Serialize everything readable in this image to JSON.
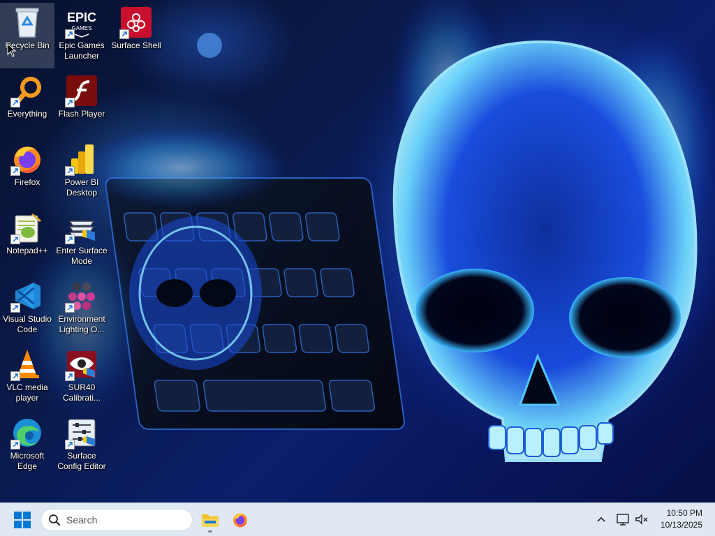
{
  "desktop": {
    "wallpaper": "blue-flame-skull-keyboard",
    "icons": [
      {
        "id": "recycle-bin",
        "label": "Recycle Bin",
        "icon": "recycle-bin-icon",
        "shortcut": false,
        "selected": true
      },
      {
        "id": "epic-games",
        "label": "Epic Games Launcher",
        "icon": "epic-games-icon",
        "shortcut": true
      },
      {
        "id": "surface-shell",
        "label": "Surface Shell",
        "icon": "surface-shell-icon",
        "shortcut": true
      },
      {
        "id": "everything",
        "label": "Everything",
        "icon": "magnifier-icon",
        "shortcut": true
      },
      {
        "id": "flash-player",
        "label": "Flash Player",
        "icon": "flash-icon",
        "shortcut": true
      },
      {
        "id": "firefox",
        "label": "Firefox",
        "icon": "firefox-icon",
        "shortcut": true
      },
      {
        "id": "power-bi",
        "label": "Power BI Desktop",
        "icon": "power-bi-icon",
        "shortcut": true
      },
      {
        "id": "notepadpp",
        "label": "Notepad++",
        "icon": "notepad-plus-plus-icon",
        "shortcut": true
      },
      {
        "id": "enter-surface-mode",
        "label": "Enter Surface Mode",
        "icon": "surface-mode-icon",
        "shortcut": true
      },
      {
        "id": "vscode",
        "label": "Visual Studio Code",
        "icon": "vscode-icon",
        "shortcut": true
      },
      {
        "id": "environment-lighting",
        "label": "Environment Lighting O...",
        "icon": "environment-lighting-icon",
        "shortcut": true
      },
      {
        "id": "vlc",
        "label": "VLC media player",
        "icon": "vlc-cone-icon",
        "shortcut": true
      },
      {
        "id": "sur40",
        "label": "SUR40 Calibrati...",
        "icon": "sur40-eye-icon",
        "shortcut": true
      },
      {
        "id": "edge",
        "label": "Microsoft Edge",
        "icon": "edge-icon",
        "shortcut": true
      },
      {
        "id": "surface-config",
        "label": "Surface Config Editor",
        "icon": "config-sliders-icon",
        "shortcut": true
      }
    ]
  },
  "taskbar": {
    "search_placeholder": "Search",
    "apps": [
      {
        "id": "file-explorer",
        "icon": "folder-icon",
        "running": true
      },
      {
        "id": "firefox",
        "icon": "firefox-icon",
        "running": false
      }
    ],
    "tray": [
      "chevron-up-icon",
      "network-icon",
      "volume-muted-icon"
    ],
    "time": "10:50 PM",
    "date": "10/13/2025"
  },
  "colors": {
    "taskbar_bg": "#dfe8f3",
    "accent": "#0067c0",
    "wallpaper_blue": "#1e5bff"
  }
}
